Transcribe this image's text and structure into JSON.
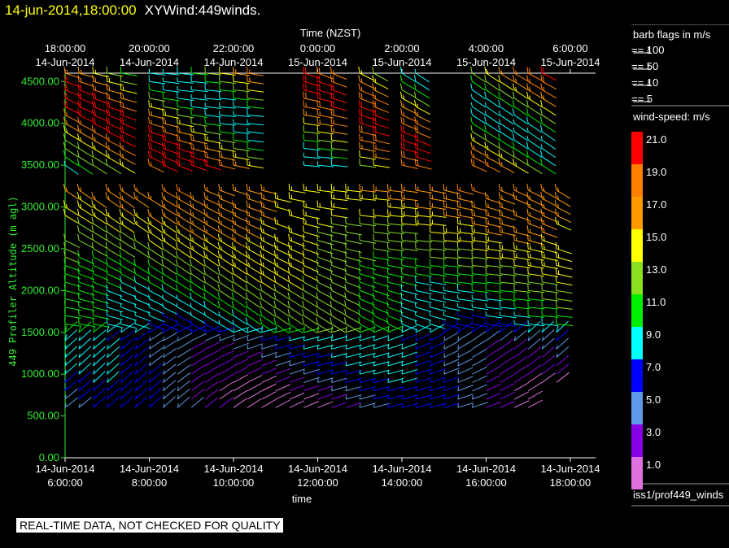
{
  "header": {
    "timestamp": "14-jun-2014,18:00:00",
    "title": "XYWind:449winds."
  },
  "chart_data": {
    "type": "wind-barb",
    "top_axis_title": "Time (NZST)",
    "top_ticks": [
      {
        "time": "18:00:00",
        "date": "14-Jun-2014"
      },
      {
        "time": "20:00:00",
        "date": "14-Jun-2014"
      },
      {
        "time": "22:00:00",
        "date": "14-Jun-2014"
      },
      {
        "time": "0:00:00",
        "date": "15-Jun-2014"
      },
      {
        "time": "2:00:00",
        "date": "15-Jun-2014"
      },
      {
        "time": "4:00:00",
        "date": "15-Jun-2014"
      },
      {
        "time": "6:00:00",
        "date": "15-Jun-2014"
      }
    ],
    "bottom_ticks": [
      {
        "date": "14-Jun-2014",
        "time": "6:00:00"
      },
      {
        "date": "14-Jun-2014",
        "time": "8:00:00"
      },
      {
        "date": "14-Jun-2014",
        "time": "10:00:00"
      },
      {
        "date": "14-Jun-2014",
        "time": "12:00:00"
      },
      {
        "date": "14-Jun-2014",
        "time": "14:00:00"
      },
      {
        "date": "14-Jun-2014",
        "time": "16:00:00"
      },
      {
        "date": "14-Jun-2014",
        "time": "18:00:00"
      }
    ],
    "xlabel": "time",
    "xlim_hours": [
      6,
      18.6
    ],
    "ylabel": "449 Profiler Altitude (m agl)",
    "ylim": [
      0,
      4600
    ],
    "y_ticks": [
      "0.00",
      "500.00",
      "1000.00",
      "1500.00",
      "2000.00",
      "2500.00",
      "3000.00",
      "3500.00",
      "4000.00",
      "4500.00"
    ],
    "barb_flags": {
      "title": "barb flags in m/s",
      "items": [
        {
          "label": "== 100"
        },
        {
          "label": "== 50"
        },
        {
          "label": "== 10"
        },
        {
          "label": "== 5"
        }
      ]
    },
    "color_scale": {
      "title": "wind-speed: m/s",
      "bins": [
        {
          "label": "21.0",
          "color": "#ff0000"
        },
        {
          "label": "19.0",
          "color": "#ff8000"
        },
        {
          "label": "17.0",
          "color": "#ff9a00"
        },
        {
          "label": "15.0",
          "color": "#ffff00"
        },
        {
          "label": "13.0",
          "color": "#88e020"
        },
        {
          "label": "11.0",
          "color": "#00ee00"
        },
        {
          "label": "9.0",
          "color": "#00ffff"
        },
        {
          "label": "7.0",
          "color": "#0000ff"
        },
        {
          "label": "5.0",
          "color": "#5c99e6"
        },
        {
          "label": "3.0",
          "color": "#8a00e6"
        },
        {
          "label": "1.0",
          "color": "#e070e0"
        }
      ]
    },
    "profiles_low_mode": {
      "times_hours": [
        6.0,
        6.33,
        6.67,
        7.0,
        7.33,
        7.67,
        8.0,
        8.33,
        8.67,
        9.0,
        9.33,
        9.67,
        10.0,
        10.33,
        10.67,
        11.0,
        11.33,
        11.67,
        12.0,
        12.33,
        12.67,
        13.0,
        13.33,
        13.67,
        14.0,
        14.33,
        14.67,
        15.0,
        15.33,
        15.67,
        16.0,
        16.33,
        16.67,
        17.0,
        17.33,
        17.67
      ],
      "altitudes_m": [
        600,
        700,
        800,
        900,
        1000,
        1100,
        1200,
        1300,
        1400,
        1500,
        1600,
        1700,
        1800,
        1900,
        2000,
        2100,
        2200,
        2300,
        2400,
        2500,
        2600,
        2700,
        2800,
        2900,
        3000,
        3100,
        3200
      ]
    },
    "profiles_high_mode": {
      "times_hours": [
        6.0,
        6.33,
        6.67,
        7.0,
        7.33,
        8.0,
        8.33,
        8.67,
        9.0,
        9.33,
        9.67,
        10.0,
        10.33,
        11.67,
        12.0,
        12.33,
        13.0,
        13.33,
        14.0,
        14.33,
        15.67,
        16.0,
        16.33,
        16.67,
        17.0,
        17.33
      ],
      "altitudes_m": [
        3500,
        3600,
        3700,
        3800,
        3900,
        4000,
        4100,
        4200,
        4300,
        4400,
        4500,
        4600
      ]
    }
  },
  "source_label": "iss1/prof449_winds",
  "warning": "REAL-TIME DATA, NOT CHECKED FOR QUALITY"
}
